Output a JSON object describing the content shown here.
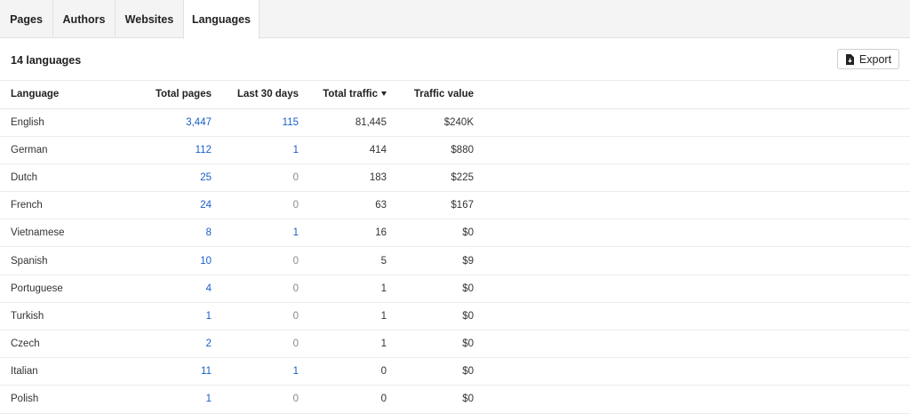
{
  "tabs": [
    "Pages",
    "Authors",
    "Websites",
    "Languages"
  ],
  "header": {
    "count_label": "14 languages",
    "export_label": "Export"
  },
  "columns": {
    "language": "Language",
    "total_pages": "Total pages",
    "last_30_days": "Last 30 days",
    "total_traffic": "Total traffic",
    "traffic_value": "Traffic value"
  },
  "rows": [
    {
      "language": "English",
      "total_pages": "3,447",
      "last_30_days": "115",
      "total_traffic": "81,445",
      "traffic_value": "$240K"
    },
    {
      "language": "German",
      "total_pages": "112",
      "last_30_days": "1",
      "total_traffic": "414",
      "traffic_value": "$880"
    },
    {
      "language": "Dutch",
      "total_pages": "25",
      "last_30_days": "0",
      "total_traffic": "183",
      "traffic_value": "$225"
    },
    {
      "language": "French",
      "total_pages": "24",
      "last_30_days": "0",
      "total_traffic": "63",
      "traffic_value": "$167"
    },
    {
      "language": "Vietnamese",
      "total_pages": "8",
      "last_30_days": "1",
      "total_traffic": "16",
      "traffic_value": "$0"
    },
    {
      "language": "Spanish",
      "total_pages": "10",
      "last_30_days": "0",
      "total_traffic": "5",
      "traffic_value": "$9"
    },
    {
      "language": "Portuguese",
      "total_pages": "4",
      "last_30_days": "0",
      "total_traffic": "1",
      "traffic_value": "$0"
    },
    {
      "language": "Turkish",
      "total_pages": "1",
      "last_30_days": "0",
      "total_traffic": "1",
      "traffic_value": "$0"
    },
    {
      "language": "Czech",
      "total_pages": "2",
      "last_30_days": "0",
      "total_traffic": "1",
      "traffic_value": "$0"
    },
    {
      "language": "Italian",
      "total_pages": "11",
      "last_30_days": "1",
      "total_traffic": "0",
      "traffic_value": "$0"
    },
    {
      "language": "Polish",
      "total_pages": "1",
      "last_30_days": "0",
      "total_traffic": "0",
      "traffic_value": "$0"
    }
  ],
  "colors": {
    "link": "#1a5ec9",
    "muted": "#8a8a8a",
    "tabbar_bg": "#f4f4f4"
  },
  "icons": {
    "export": "file-download-icon",
    "sort": "sort-desc-icon"
  }
}
